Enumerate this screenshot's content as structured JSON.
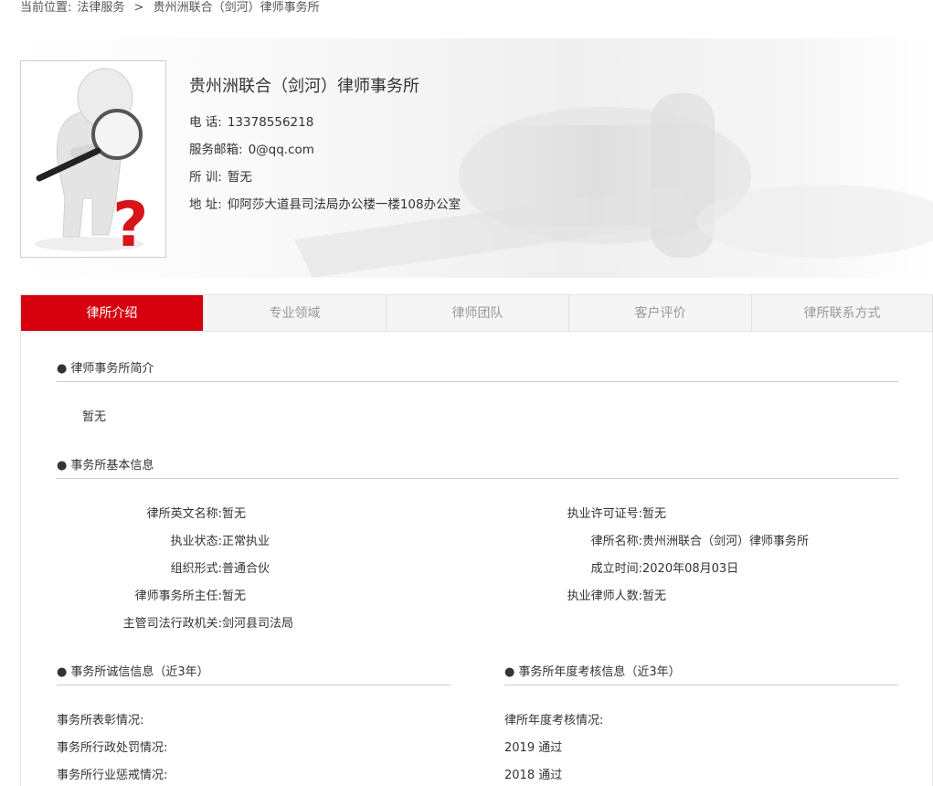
{
  "breadcrumb": {
    "prefix": "当前位置:",
    "items": [
      "法律服务",
      ">",
      "贵州洲联合（剑河）律师事务所"
    ]
  },
  "firm": {
    "name": "贵州洲联合（剑河）律师事务所",
    "phone_label": "电 话:",
    "phone": "13378556218",
    "email_label": "服务邮箱:",
    "email": "0@qq.com",
    "motto_label": "所 训:",
    "motto": "暂无",
    "address_label": "地 址:",
    "address": "仰阿莎大道县司法局办公楼一楼108办公室"
  },
  "tabs": [
    {
      "label": "律所介绍",
      "active": true
    },
    {
      "label": "专业领域",
      "active": false
    },
    {
      "label": "律师团队",
      "active": false
    },
    {
      "label": "客户评价",
      "active": false
    },
    {
      "label": "律所联系方式",
      "active": false
    }
  ],
  "intro": {
    "heading": "律师事务所简介",
    "text": "暂无"
  },
  "basic": {
    "heading": "事务所基本信息",
    "left": [
      {
        "k": "律所英文名称:",
        "v": "暂无"
      },
      {
        "k": "执业状态:",
        "v": "正常执业"
      },
      {
        "k": "组织形式:",
        "v": "普通合伙"
      },
      {
        "k": "律师事务所主任:",
        "v": "暂无"
      },
      {
        "k": "主管司法行政机关:",
        "v": "剑河县司法局"
      }
    ],
    "right": [
      {
        "k": "执业许可证号:",
        "v": "暂无"
      },
      {
        "k": "律所名称:",
        "v": "贵州洲联合（剑河）律师事务所"
      },
      {
        "k": "成立时间:",
        "v": "2020年08月03日"
      },
      {
        "k": "执业律师人数:",
        "v": "暂无"
      }
    ]
  },
  "credit": {
    "heading": "事务所诚信信息（近3年）",
    "items": [
      "事务所表彰情况:",
      "事务所行政处罚情况:",
      "事务所行业惩戒情况:"
    ]
  },
  "annual": {
    "heading": "事务所年度考核信息（近3年）",
    "items": [
      "律所年度考核情况:",
      "2019 通过",
      "2018 通过"
    ]
  },
  "colors": {
    "accent": "#d7000f"
  }
}
